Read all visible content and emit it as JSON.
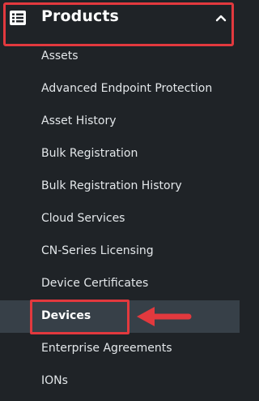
{
  "header": {
    "title": "Products",
    "icon": "list-icon",
    "chevron": "chevron-up-icon"
  },
  "items": [
    {
      "label": "Assets"
    },
    {
      "label": "Advanced Endpoint Protection"
    },
    {
      "label": "Asset History"
    },
    {
      "label": "Bulk Registration"
    },
    {
      "label": "Bulk Registration History"
    },
    {
      "label": "Cloud Services"
    },
    {
      "label": "CN-Series Licensing"
    },
    {
      "label": "Device Certificates"
    },
    {
      "label": "Devices"
    },
    {
      "label": "Enterprise Agreements"
    },
    {
      "label": "IONs"
    }
  ],
  "active_item": "Devices",
  "colors": {
    "background": "#1f2327",
    "active_background": "#374048",
    "highlight": "#e2393e",
    "text": "#e3e7ea"
  }
}
